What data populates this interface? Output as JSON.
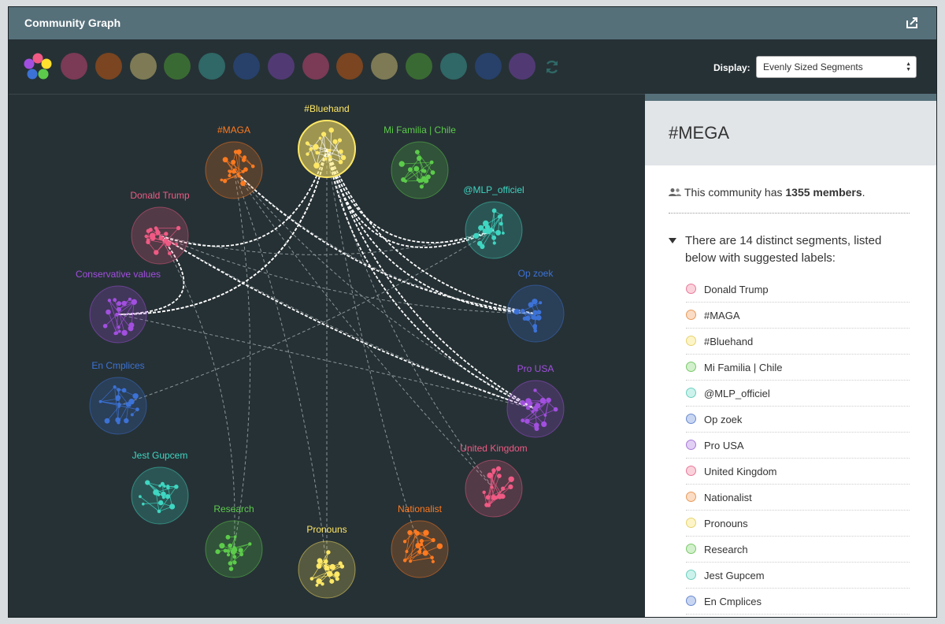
{
  "panel": {
    "title": "Community Graph",
    "share_icon": "share-icon"
  },
  "toolbar": {
    "swatches": [
      "#7b3a56",
      "#7a4520",
      "#7d7a55",
      "#3a6a33",
      "#2f6866",
      "#27416b",
      "#513a74",
      "#7b3a56",
      "#7a4520",
      "#7d7a55",
      "#3a6a33",
      "#2f6866",
      "#27416b",
      "#513a74"
    ],
    "display_label": "Display:",
    "display_value": "Evenly Sized Segments",
    "refresh_icon": "refresh-icon"
  },
  "graph": {
    "communities": [
      {
        "label": "Donald Trump",
        "color": "#f05a84"
      },
      {
        "label": "#MAGA",
        "color": "#ff7a1f"
      },
      {
        "label": "#Bluehand",
        "color": "#ffe866"
      },
      {
        "label": "Mi Familia | Chile",
        "color": "#5ccb4b"
      },
      {
        "label": "@MLP_officiel",
        "color": "#3fd6c2"
      },
      {
        "label": "Op zoek",
        "color": "#3c72d6"
      },
      {
        "label": "Pro USA",
        "color": "#a24fe0"
      },
      {
        "label": "United Kingdom",
        "color": "#f05a84"
      },
      {
        "label": "Nationalist",
        "color": "#ff7a1f"
      },
      {
        "label": "Pronouns",
        "color": "#ffe866"
      },
      {
        "label": "Research",
        "color": "#5ccb4b"
      },
      {
        "label": "Jest Gupcem",
        "color": "#3fd6c2"
      },
      {
        "label": "En Cmplices",
        "color": "#3c72d6"
      },
      {
        "label": "Conservative values",
        "color": "#a24fe0"
      }
    ]
  },
  "sidebar": {
    "community_name": "#MEGA",
    "member_text_prefix": "This community has ",
    "member_count": "1355 members",
    "member_text_suffix": ".",
    "segments_heading": "There are 14 distinct segments, listed below with suggested labels:",
    "segments": [
      {
        "label": "Donald Trump",
        "fill": "#fad2dc",
        "stroke": "#e87a9a"
      },
      {
        "label": "#MAGA",
        "fill": "#fbdcc4",
        "stroke": "#e89a5a"
      },
      {
        "label": "#Bluehand",
        "fill": "#fdf5c8",
        "stroke": "#e6d270"
      },
      {
        "label": "Mi Familia | Chile",
        "fill": "#d2f0cc",
        "stroke": "#7ac86a"
      },
      {
        "label": "@MLP_officiel",
        "fill": "#cdf2ec",
        "stroke": "#6ccfbf"
      },
      {
        "label": "Op zoek",
        "fill": "#c9d6f2",
        "stroke": "#6a8ad0"
      },
      {
        "label": "Pro USA",
        "fill": "#e2cff4",
        "stroke": "#a77ad8"
      },
      {
        "label": "United Kingdom",
        "fill": "#fad2dc",
        "stroke": "#e87a9a"
      },
      {
        "label": "Nationalist",
        "fill": "#fbdcc4",
        "stroke": "#e89a5a"
      },
      {
        "label": "Pronouns",
        "fill": "#fdf5c8",
        "stroke": "#e6d270"
      },
      {
        "label": "Research",
        "fill": "#d2f0cc",
        "stroke": "#7ac86a"
      },
      {
        "label": "Jest Gupcem",
        "fill": "#cdf2ec",
        "stroke": "#6ccfbf"
      },
      {
        "label": "En Cmplices",
        "fill": "#c9d6f2",
        "stroke": "#6a8ad0"
      }
    ]
  }
}
